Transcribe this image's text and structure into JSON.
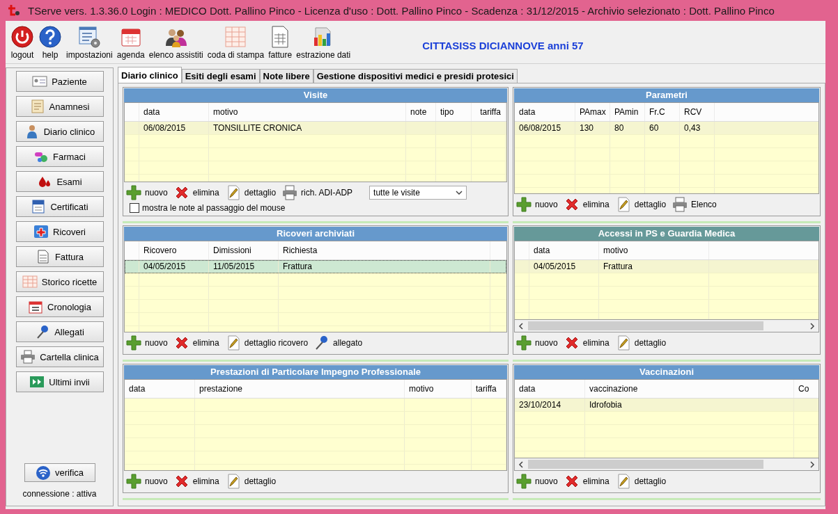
{
  "window": {
    "title": "TServe vers. 1.3.36.0  Login : MEDICO Dott. Pallino Pinco - Licenza d'uso : Dott. Pallino Pinco - Scadenza : 31/12/2015 - Archivio selezionato : Dott. Pallino Pinco"
  },
  "toolbar": [
    {
      "label": "logout"
    },
    {
      "label": "help"
    },
    {
      "label": "impostazioni"
    },
    {
      "label": "agenda"
    },
    {
      "label": "elenco assistiti"
    },
    {
      "label": "coda di stampa"
    },
    {
      "label": "fatture"
    },
    {
      "label": "estrazione dati"
    }
  ],
  "patient": "CITTASISS DICIANNOVE anni 57",
  "sidebar": {
    "items": [
      {
        "label": "Paziente"
      },
      {
        "label": "Anamnesi"
      },
      {
        "label": "Diario clinico"
      },
      {
        "label": "Farmaci"
      },
      {
        "label": "Esami"
      },
      {
        "label": "Certificati"
      },
      {
        "label": "Ricoveri"
      },
      {
        "label": "Fattura"
      },
      {
        "label": "Storico ricette"
      },
      {
        "label": "Cronologia"
      },
      {
        "label": "Allegati"
      },
      {
        "label": "Cartella clinica"
      },
      {
        "label": "Ultimi invii"
      }
    ],
    "verify_button": "verifica",
    "connection": "connessione : attiva"
  },
  "tabs": [
    {
      "label": "Diario clinico",
      "selected": true
    },
    {
      "label": "Esiti degli esami",
      "selected": false
    },
    {
      "label": "Note libere",
      "selected": false
    },
    {
      "label": "Gestione dispositivi medici e presidi protesici",
      "selected": false
    }
  ],
  "panels": [
    {
      "title": "Visite",
      "color": "#6699cc",
      "row_marker": true,
      "scrollbar": false,
      "columns": [
        "data",
        "motivo",
        "note",
        "tipo",
        "tariffa"
      ],
      "rows": [
        {
          "cells": [
            "06/08/2015",
            "TONSILLITE CRONICA",
            "",
            "",
            ""
          ],
          "selected": false
        }
      ],
      "actions": [
        {
          "kind": "add",
          "label": "nuovo"
        },
        {
          "kind": "delete",
          "label": "elimina"
        },
        {
          "kind": "edit",
          "label": "dettaglio"
        },
        {
          "kind": "print",
          "label": "rich. ADI-ADP"
        }
      ],
      "filter": {
        "value": "tutte le visite"
      },
      "option": {
        "label": "mostra le note al passaggio del mouse",
        "checked": false
      }
    },
    {
      "title": "Parametri",
      "color": "#6699cc",
      "row_marker": false,
      "scrollbar": false,
      "columns": [
        "data",
        "PAmax",
        "PAmin",
        "Fr.C",
        "RCV"
      ],
      "rows": [
        {
          "cells": [
            "06/08/2015",
            "130",
            "80",
            "60",
            "0,43"
          ],
          "selected": false
        }
      ],
      "actions": [
        {
          "kind": "add",
          "label": "nuovo"
        },
        {
          "kind": "delete",
          "label": "elimina"
        },
        {
          "kind": "edit",
          "label": "dettaglio"
        },
        {
          "kind": "print",
          "label": "Elenco"
        }
      ]
    },
    {
      "title": "Ricoveri archiviati",
      "color": "#6699cc",
      "row_marker": true,
      "scrollbar": false,
      "columns": [
        "Ricovero",
        "Dimissioni",
        "Richiesta"
      ],
      "rows": [
        {
          "cells": [
            "04/05/2015",
            "11/05/2015",
            "Frattura"
          ],
          "selected": true
        }
      ],
      "actions": [
        {
          "kind": "add",
          "label": "nuovo"
        },
        {
          "kind": "delete",
          "label": "elimina"
        },
        {
          "kind": "edit",
          "label": "dettaglio ricovero"
        },
        {
          "kind": "pin",
          "label": "allegato"
        }
      ]
    },
    {
      "title": "Accessi in PS e Guardia Medica",
      "color": "#669999",
      "row_marker": true,
      "scrollbar": true,
      "columns": [
        "data",
        "motivo"
      ],
      "rows": [
        {
          "cells": [
            "04/05/2015",
            "Frattura"
          ],
          "selected": false
        }
      ],
      "actions": [
        {
          "kind": "add",
          "label": "nuovo"
        },
        {
          "kind": "delete",
          "label": "elimina"
        },
        {
          "kind": "edit",
          "label": "dettaglio"
        }
      ]
    },
    {
      "title": "Prestazioni di Particolare Impegno Professionale",
      "color": "#6699cc",
      "row_marker": false,
      "scrollbar": false,
      "columns": [
        "data",
        "prestazione",
        "motivo",
        "tariffa"
      ],
      "actions": [
        {
          "kind": "add",
          "label": "nuovo"
        },
        {
          "kind": "delete",
          "label": "elimina"
        },
        {
          "kind": "edit",
          "label": "dettaglio"
        }
      ]
    },
    {
      "title": "Vaccinazioni",
      "color": "#6699cc",
      "row_marker": false,
      "scrollbar": true,
      "columns": [
        "data",
        "vaccinazione",
        "Co"
      ],
      "rows": [
        {
          "cells": [
            "23/10/2014",
            "Idrofobia",
            ""
          ],
          "selected": false
        }
      ],
      "actions": [
        {
          "kind": "add",
          "label": "nuovo"
        },
        {
          "kind": "delete",
          "label": "elimina"
        },
        {
          "kind": "edit",
          "label": "dettaglio"
        }
      ]
    }
  ]
}
